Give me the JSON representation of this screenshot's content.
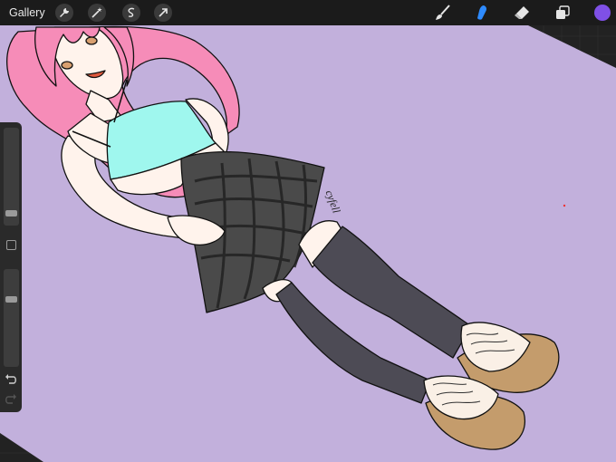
{
  "app": {
    "gallery_label": "Gallery"
  },
  "toolbar": {
    "left_tools": [
      "actions-wrench",
      "adjustments-wand",
      "selection",
      "transform-arrow"
    ],
    "right_tools": [
      "brush",
      "smudge",
      "eraser",
      "layers"
    ],
    "active_tool": "smudge"
  },
  "colors": {
    "accent": "#2e8bff",
    "current_color": "#7f50e6",
    "canvas_bg": "#c2b0dc",
    "hair": "#f68cb8",
    "top": "#9ff7ee",
    "skirt": "#4a4a4a",
    "socks": "#4d4b55",
    "shoe_sole": "#c49c6c",
    "shoe_upper": "#faf0e6"
  },
  "sidebar": {
    "brush_size_level": 0.9,
    "opacity_level": 0.7
  },
  "artwork": {
    "signature": "cyfell"
  }
}
